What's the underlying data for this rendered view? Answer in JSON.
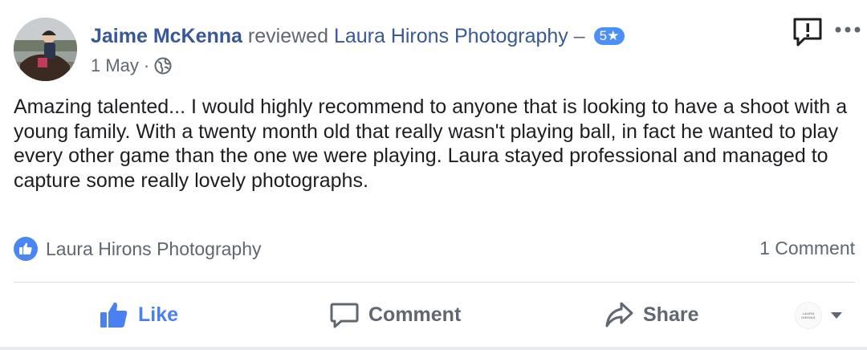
{
  "header": {
    "author": "Jaime McKenna",
    "action": "reviewed",
    "page_name": "Laura Hirons Photography",
    "separator": "–",
    "rating_label": "5★",
    "date": "1 May",
    "dot": "·",
    "privacy_icon": "globe-icon"
  },
  "review": {
    "text": "Amazing talented... I would highly recommend to anyone that is looking to have a shoot with a young family. With a twenty month old that really wasn't playing ball, in fact he wanted to play every other game than the one we were playing. Laura stayed professional and managed to capture some really lovely photographs."
  },
  "reactions": {
    "icon": "like-icon",
    "names": "Laura Hirons Photography",
    "comment_count": "1 Comment"
  },
  "actions": {
    "like_label": "Like",
    "comment_label": "Comment",
    "share_label": "Share"
  },
  "page_selector": {
    "avatar_text": "LAURA HIRONS"
  },
  "colors": {
    "link": "#385898",
    "accent": "#4a80f0",
    "muted": "#606770",
    "text": "#1c1e21",
    "divider": "#dadde1"
  }
}
